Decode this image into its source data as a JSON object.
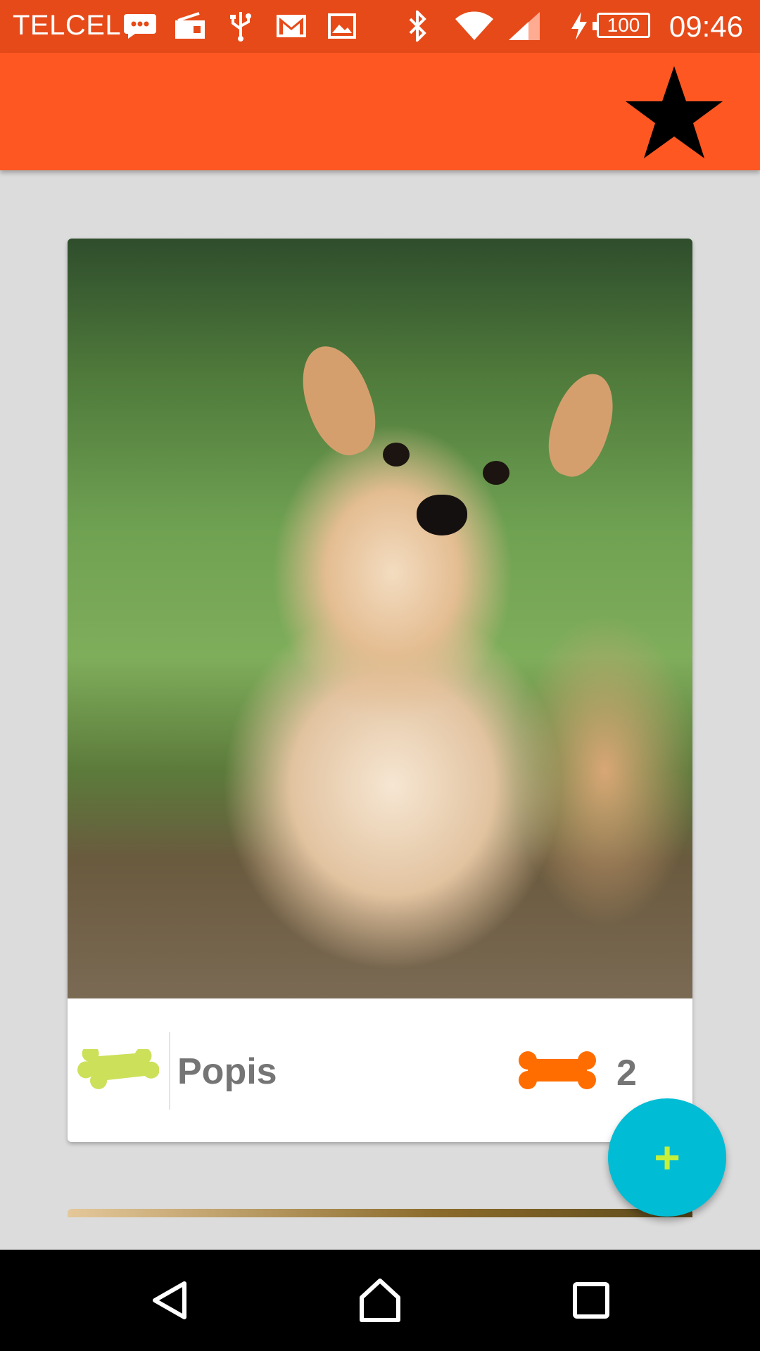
{
  "status_bar": {
    "carrier": "TELCEL",
    "battery": "100",
    "time": "09:46",
    "icons": [
      "message-icon",
      "radio-icon",
      "usb-icon",
      "gmail-icon",
      "image-icon",
      "bluetooth-icon",
      "wifi-icon",
      "signal-icon",
      "charging-icon"
    ]
  },
  "app_bar": {
    "action_icon": "star-icon"
  },
  "pet_card": {
    "photo": "puppy-photo",
    "toy_icon": "green-bone-toy",
    "name": "Popis",
    "bone_icon": "orange-bone-icon",
    "bone_count": "2"
  },
  "fab": {
    "label": "+"
  },
  "colors": {
    "status_bar": "#e64a19",
    "app_bar": "#ff5722",
    "background": "#dcdcdc",
    "fab": "#00bcd4",
    "fab_icon": "#c6ef3a",
    "bone": "#ff6d00",
    "text_gray": "#757575"
  },
  "nav_bar": {
    "buttons": [
      "back-icon",
      "home-icon",
      "recents-icon"
    ]
  }
}
